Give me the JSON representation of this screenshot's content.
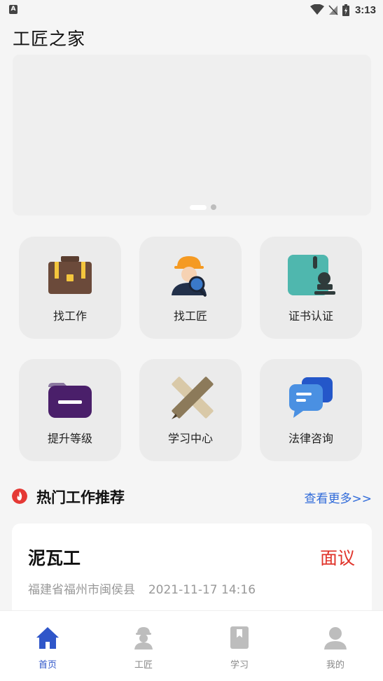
{
  "status_bar": {
    "time": "3:13",
    "left_icon": "A"
  },
  "app": {
    "title": "工匠之家"
  },
  "banner": {
    "pages": 2,
    "active_page": 1
  },
  "features": [
    {
      "label": "找工作",
      "icon": "briefcase-icon"
    },
    {
      "label": "找工匠",
      "icon": "worker-search-icon"
    },
    {
      "label": "证书认证",
      "icon": "certificate-stamp-icon"
    },
    {
      "label": "提升等级",
      "icon": "folder-icon"
    },
    {
      "label": "学习中心",
      "icon": "pencil-ruler-icon"
    },
    {
      "label": "法律咨询",
      "icon": "chat-bubbles-icon"
    }
  ],
  "hot_jobs": {
    "title": "热门工作推荐",
    "more_label": "查看更多>>",
    "items": [
      {
        "name": "泥瓦工",
        "salary": "面议",
        "location": "福建省福州市闽侯县",
        "date": "2021-11-17 14:16"
      }
    ]
  },
  "tabs": [
    {
      "label": "首页",
      "icon": "home-icon",
      "active": true
    },
    {
      "label": "工匠",
      "icon": "worker-icon",
      "active": false
    },
    {
      "label": "学习",
      "icon": "book-icon",
      "active": false
    },
    {
      "label": "我的",
      "icon": "user-icon",
      "active": false
    }
  ],
  "colors": {
    "accent": "#2f56c9",
    "salary": "#e0342b",
    "more_link": "#2f6ad9"
  }
}
